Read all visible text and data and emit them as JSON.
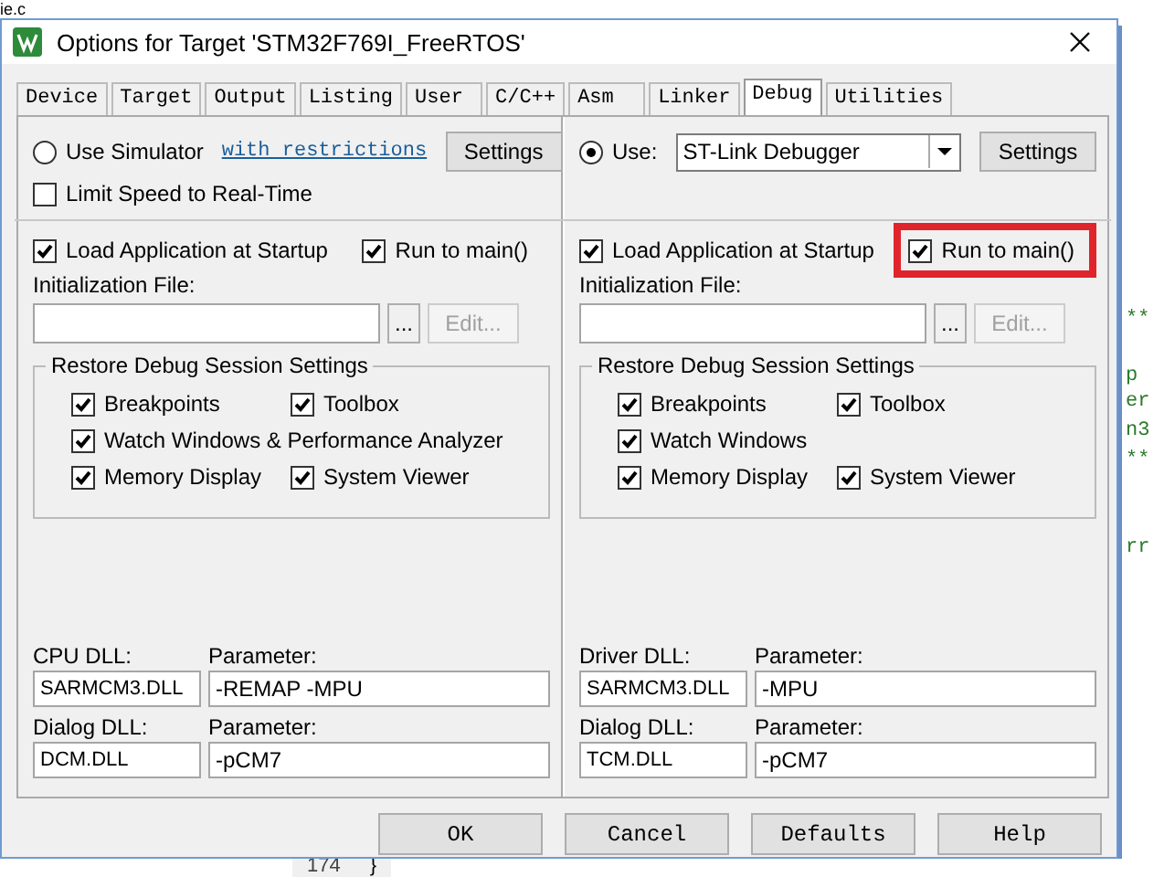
{
  "editor": {
    "file_tab": "ie.c",
    "line_number": "174",
    "line_text": "}",
    "fragments": [
      "**",
      "p",
      "er",
      "n3",
      "**",
      "rr"
    ]
  },
  "dialog": {
    "title": "Options for Target 'STM32F769I_FreeRTOS'"
  },
  "tabs": [
    {
      "label": "Device",
      "selected": false
    },
    {
      "label": "Target",
      "selected": false
    },
    {
      "label": "Output",
      "selected": false
    },
    {
      "label": "Listing",
      "selected": false
    },
    {
      "label": "User",
      "selected": false
    },
    {
      "label": "C/C++",
      "selected": false
    },
    {
      "label": "Asm",
      "selected": false
    },
    {
      "label": "Linker",
      "selected": false
    },
    {
      "label": "Debug",
      "selected": true
    },
    {
      "label": "Utilities",
      "selected": false
    }
  ],
  "panes": [
    {
      "kind": "simulator",
      "use": {
        "label": "Use Simulator",
        "selected": false
      },
      "link": "with restrictions",
      "settings": "Settings",
      "limit_speed": {
        "label": "Limit Speed to Real-Time",
        "checked": false
      },
      "load_app": {
        "label": "Load Application at Startup",
        "checked": true
      },
      "run_to_main": {
        "label": "Run to main()",
        "checked": true,
        "highlighted": false
      },
      "init_label": "Initialization File:",
      "browse": "...",
      "edit": {
        "label": "Edit...",
        "disabled": true
      },
      "group": {
        "title": "Restore Debug Session Settings",
        "rows": [
          [
            {
              "label": "Breakpoints",
              "checked": true
            },
            {
              "label": "Toolbox",
              "checked": true
            }
          ],
          [
            {
              "label": "Watch Windows & Performance Analyzer",
              "checked": true
            }
          ],
          [
            {
              "label": "Memory Display",
              "checked": true
            },
            {
              "label": "System Viewer",
              "checked": true
            }
          ]
        ]
      },
      "dlls": [
        {
          "label": "CPU DLL:",
          "value": "SARMCM3.DLL",
          "param_label": "Parameter:",
          "param_value": "-REMAP -MPU"
        },
        {
          "label": "Dialog DLL:",
          "value": "DCM.DLL",
          "param_label": "Parameter:",
          "param_value": "-pCM7"
        }
      ]
    },
    {
      "kind": "target",
      "use": {
        "label": "Use:",
        "selected": true
      },
      "driver": "ST-Link Debugger",
      "settings": "Settings",
      "load_app": {
        "label": "Load Application at Startup",
        "checked": true
      },
      "run_to_main": {
        "label": "Run to main()",
        "checked": true,
        "highlighted": true
      },
      "init_label": "Initialization File:",
      "browse": "...",
      "edit": {
        "label": "Edit...",
        "disabled": true
      },
      "group": {
        "title": "Restore Debug Session Settings",
        "rows": [
          [
            {
              "label": "Breakpoints",
              "checked": true
            },
            {
              "label": "Toolbox",
              "checked": true
            }
          ],
          [
            {
              "label": "Watch Windows",
              "checked": true
            }
          ],
          [
            {
              "label": "Memory Display",
              "checked": true
            },
            {
              "label": "System Viewer",
              "checked": true
            }
          ]
        ]
      },
      "dlls": [
        {
          "label": "Driver DLL:",
          "value": "SARMCM3.DLL",
          "param_label": "Parameter:",
          "param_value": "-MPU"
        },
        {
          "label": "Dialog DLL:",
          "value": "TCM.DLL",
          "param_label": "Parameter:",
          "param_value": "-pCM7"
        }
      ]
    }
  ],
  "buttons": [
    {
      "label": "OK"
    },
    {
      "label": "Cancel"
    },
    {
      "label": "Defaults"
    },
    {
      "label": "Help"
    }
  ]
}
